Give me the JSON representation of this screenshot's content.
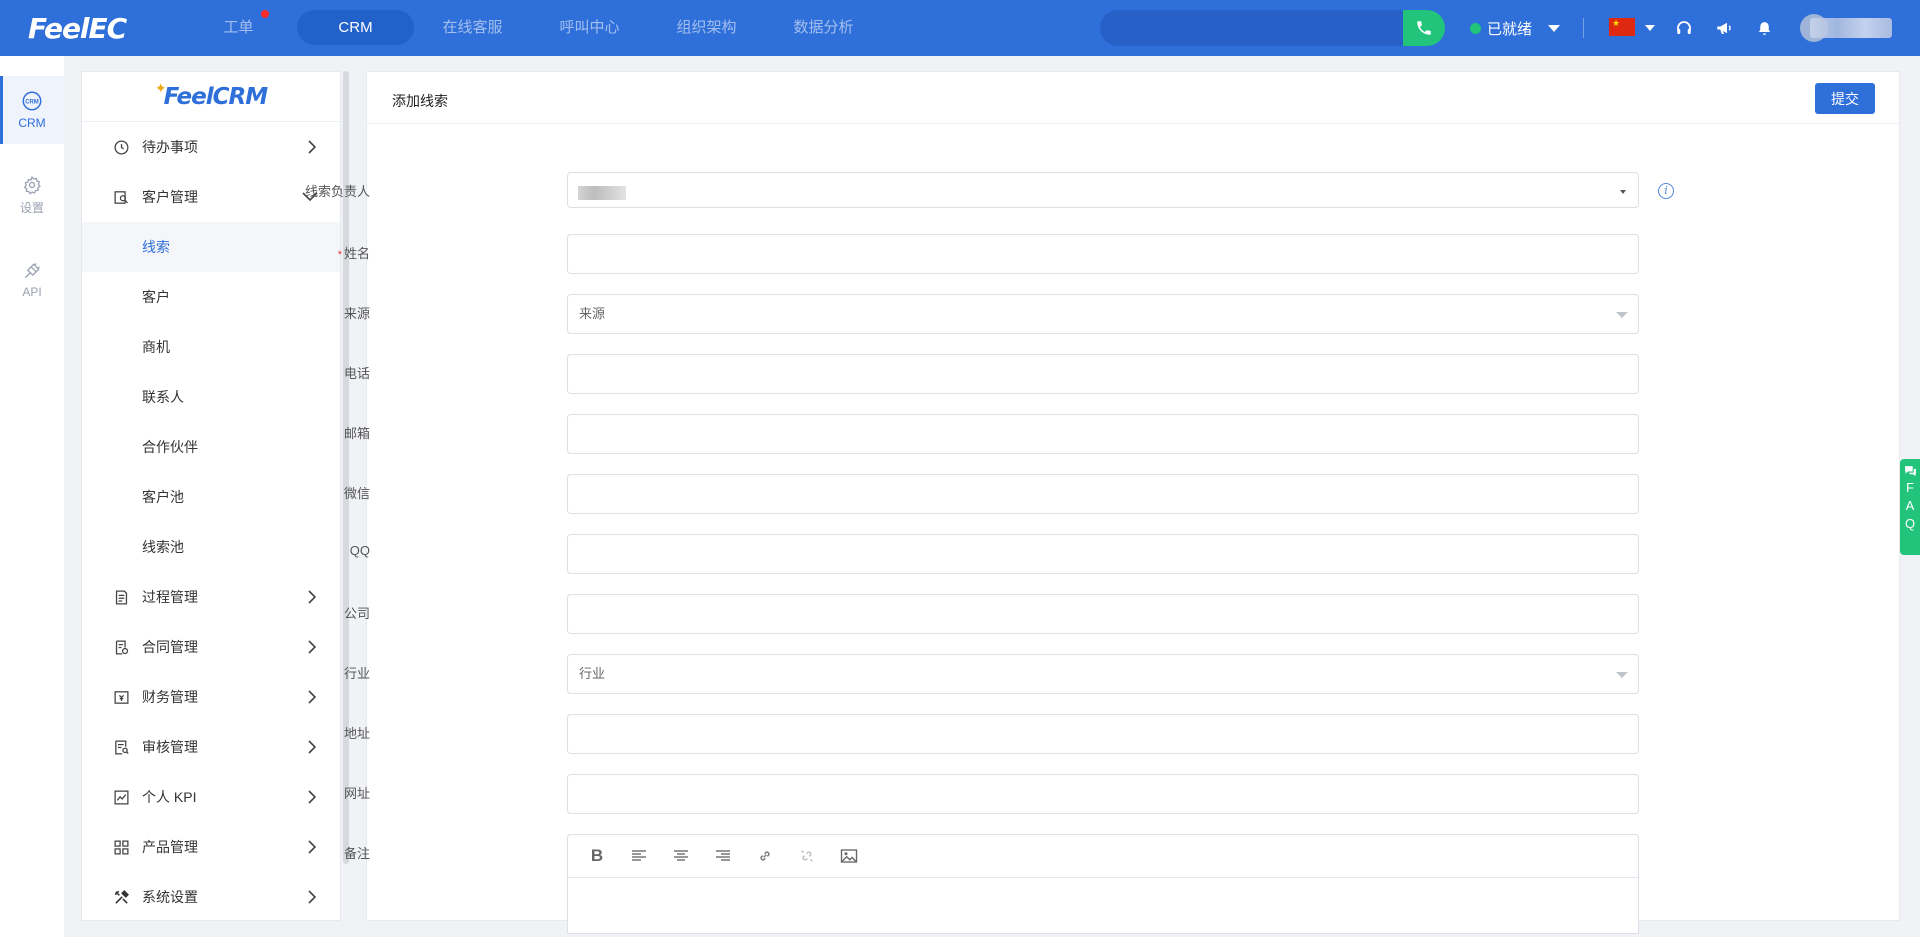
{
  "topbar": {
    "logo": "FeelEC",
    "nav": [
      {
        "label": "工单",
        "has_dot": true
      },
      {
        "label": "CRM",
        "active": true
      },
      {
        "label": "在线客服"
      },
      {
        "label": "呼叫中心"
      },
      {
        "label": "组织架构"
      },
      {
        "label": "数据分析"
      }
    ],
    "status_label": "已就绪",
    "icons": [
      "headset-icon",
      "megaphone-icon",
      "bell-icon"
    ]
  },
  "rail": {
    "items": [
      {
        "label": "CRM",
        "icon": "crm-icon",
        "active": true
      },
      {
        "label": "设置",
        "icon": "gear-icon"
      },
      {
        "label": "API",
        "icon": "plug-icon"
      }
    ]
  },
  "sidebar": {
    "logo": "FeelCRM",
    "menu": [
      {
        "label": "待办事项",
        "icon": "clock-icon",
        "expanded": false
      },
      {
        "label": "客户管理",
        "icon": "customer-icon",
        "expanded": true,
        "children": [
          "线索",
          "客户",
          "商机",
          "联系人",
          "合作伙伴",
          "客户池",
          "线索池"
        ]
      },
      {
        "label": "过程管理",
        "icon": "process-icon"
      },
      {
        "label": "合同管理",
        "icon": "contract-icon"
      },
      {
        "label": "财务管理",
        "icon": "finance-icon"
      },
      {
        "label": "审核管理",
        "icon": "audit-icon"
      },
      {
        "label": "个人 KPI",
        "icon": "chart-icon"
      },
      {
        "label": "产品管理",
        "icon": "product-icon"
      },
      {
        "label": "系统设置",
        "icon": "tools-icon"
      }
    ],
    "active_child": "线索"
  },
  "main": {
    "title": "添加线索",
    "submit_label": "提交",
    "fields": [
      {
        "label": "线索负责人",
        "type": "select-owner",
        "value": ""
      },
      {
        "label": "姓名",
        "type": "input",
        "required": true,
        "value": ""
      },
      {
        "label": "来源",
        "type": "select",
        "placeholder": "来源"
      },
      {
        "label": "电话",
        "type": "input",
        "value": ""
      },
      {
        "label": "邮箱",
        "type": "input",
        "value": ""
      },
      {
        "label": "微信",
        "type": "input",
        "value": ""
      },
      {
        "label": "QQ",
        "type": "input",
        "value": ""
      },
      {
        "label": "公司",
        "type": "input",
        "value": ""
      },
      {
        "label": "行业",
        "type": "select",
        "placeholder": "行业"
      },
      {
        "label": "地址",
        "type": "input",
        "value": ""
      },
      {
        "label": "网址",
        "type": "input",
        "value": ""
      },
      {
        "label": "备注",
        "type": "editor"
      }
    ],
    "editor_tools": [
      "bold-icon",
      "align-left-icon",
      "align-center-icon",
      "align-right-icon",
      "link-icon",
      "unlink-icon",
      "image-icon"
    ],
    "editor_bold_glyph": "B"
  },
  "faq": {
    "letters": [
      "F",
      "A",
      "Q"
    ]
  }
}
